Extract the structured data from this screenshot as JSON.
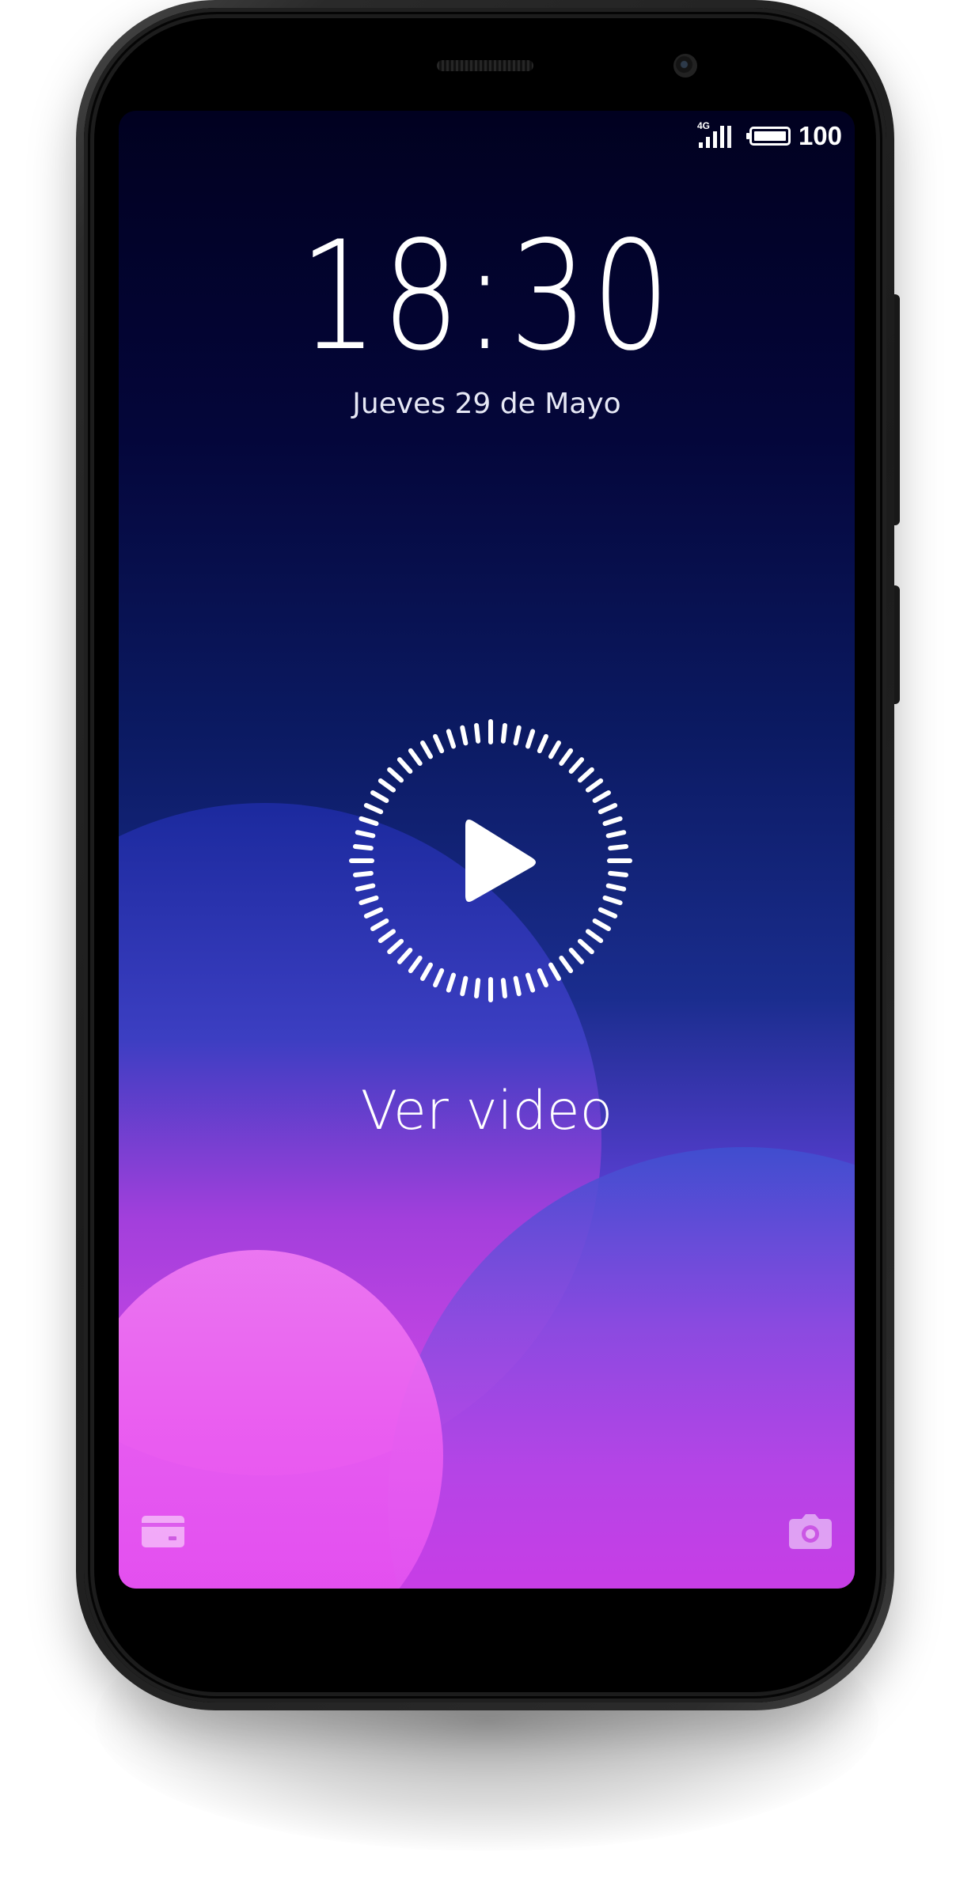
{
  "status_bar": {
    "network_label": "4G",
    "signal_icon": "signal-bars-icon",
    "battery_icon": "battery-icon",
    "battery_percent": "100"
  },
  "lock_screen": {
    "time": "18:30",
    "date": "Jueves 29 de Mayo",
    "play_icon": "play-icon",
    "cta_label": "Ver video",
    "bottom_left_icon": "card-wallet-icon",
    "bottom_right_icon": "camera-icon"
  },
  "theme": {
    "accent_magenta": "#d126e6",
    "accent_blue": "#1a2d8e",
    "background_top": "#010120"
  }
}
